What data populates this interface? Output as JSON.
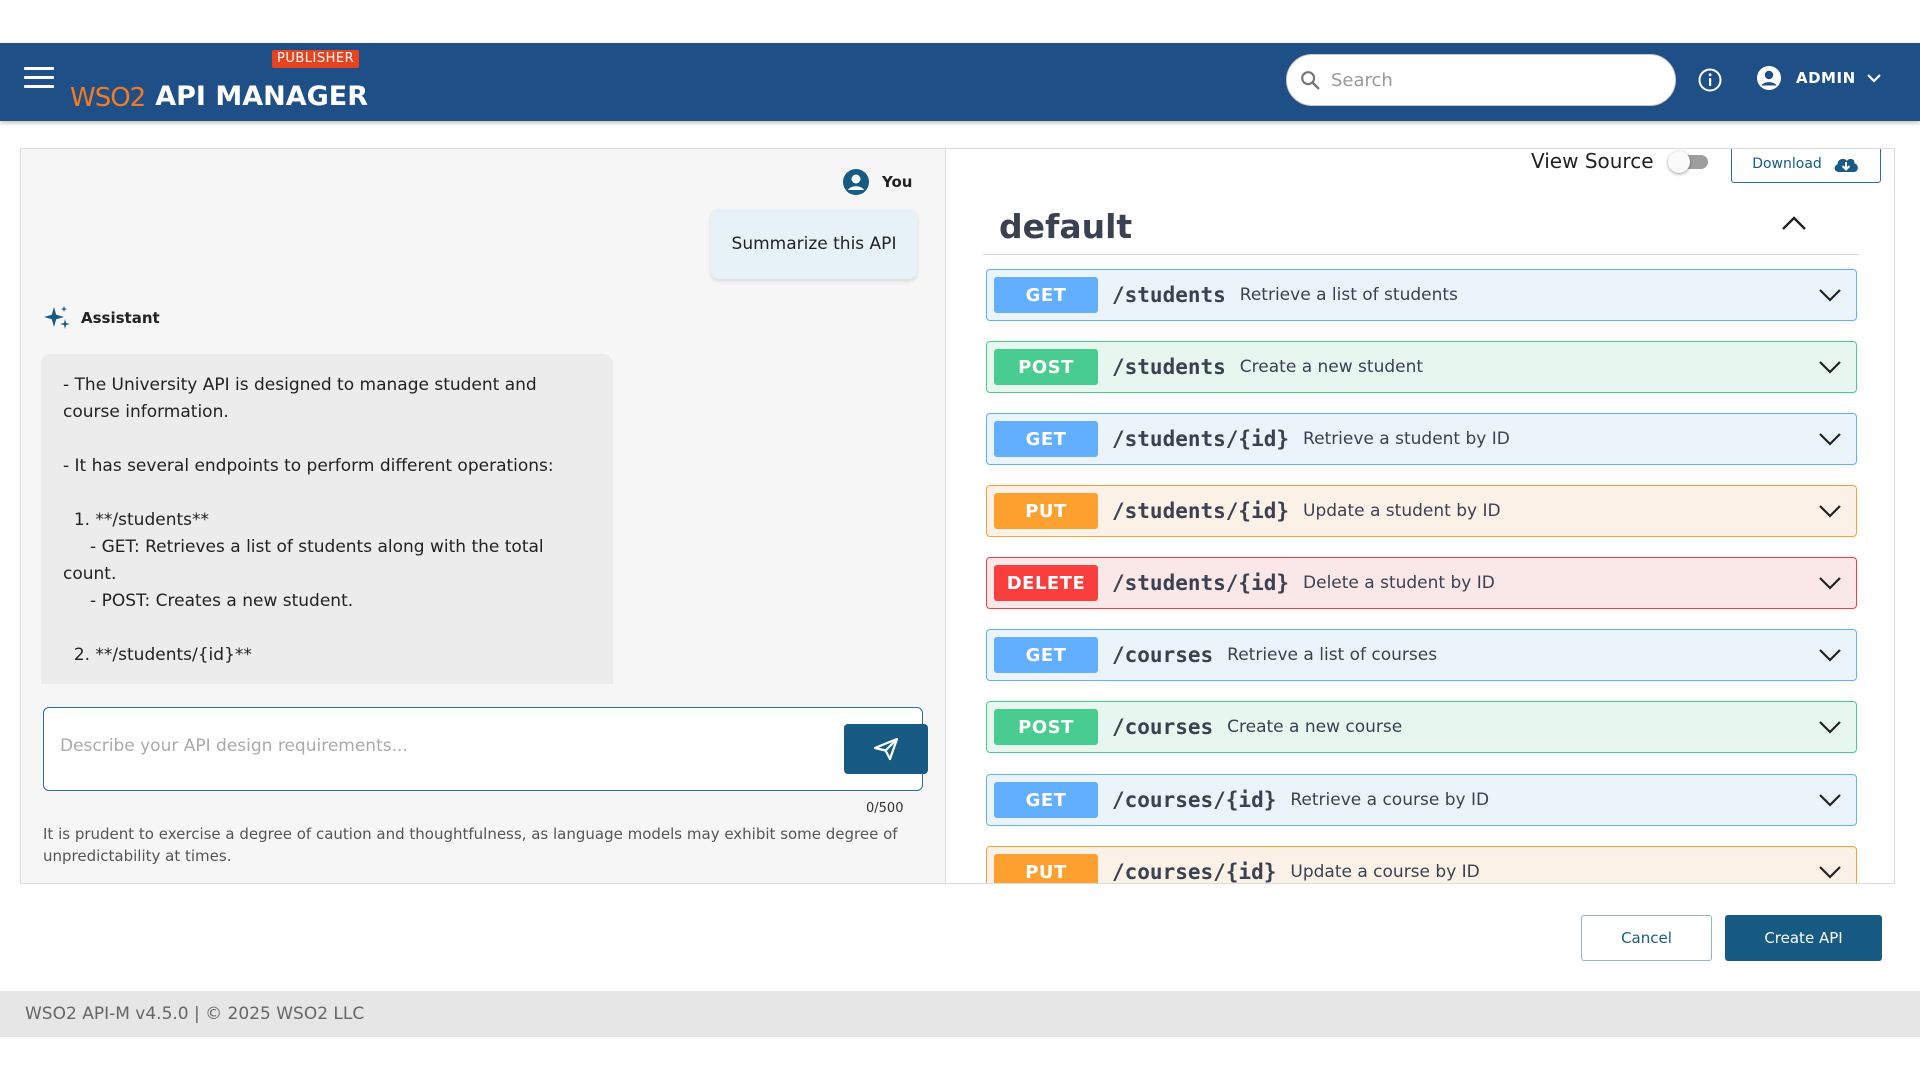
{
  "header": {
    "logo_text": "WSO2",
    "logo_sub": "2",
    "app_title": "API MANAGER",
    "badge": "PUBLISHER",
    "search_placeholder": "Search",
    "user_name": "ADMIN"
  },
  "chat": {
    "user_label": "You",
    "user_message": "Summarize this API",
    "assistant_label": "Assistant",
    "assistant_message": "- The University API is designed to manage student and course information.\n\n- It has several endpoints to perform different operations:\n\n  1. **/students**\n     - GET: Retrieves a list of students along with the total count.\n     - POST: Creates a new student.\n\n  2. **/students/{id}**",
    "input_placeholder": "Describe your API design requirements...",
    "counter": "0/500",
    "disclaimer": "It is prudent to exercise a degree of caution and thoughtfulness, as language models may exhibit some degree of unpredictability at times."
  },
  "preview": {
    "view_source_label": "View Source",
    "download_label": "Download",
    "section_title": "default",
    "operations": [
      {
        "method": "GET",
        "path": "/students",
        "summary": "Retrieve a list of students",
        "kind": "get"
      },
      {
        "method": "POST",
        "path": "/students",
        "summary": "Create a new student",
        "kind": "post"
      },
      {
        "method": "GET",
        "path": "/students/{id}",
        "summary": "Retrieve a student by ID",
        "kind": "get"
      },
      {
        "method": "PUT",
        "path": "/students/{id}",
        "summary": "Update a student by ID",
        "kind": "put"
      },
      {
        "method": "DELETE",
        "path": "/students/{id}",
        "summary": "Delete a student by ID",
        "kind": "delete"
      },
      {
        "method": "GET",
        "path": "/courses",
        "summary": "Retrieve a list of courses",
        "kind": "get"
      },
      {
        "method": "POST",
        "path": "/courses",
        "summary": "Create a new course",
        "kind": "post"
      },
      {
        "method": "GET",
        "path": "/courses/{id}",
        "summary": "Retrieve a course by ID",
        "kind": "get"
      },
      {
        "method": "PUT",
        "path": "/courses/{id}",
        "summary": "Update a course by ID",
        "kind": "put"
      }
    ]
  },
  "actions": {
    "cancel_label": "Cancel",
    "create_label": "Create API"
  },
  "footer": {
    "text": "WSO2 API-M v4.5.0 | © 2025 WSO2 LLC"
  },
  "colors": {
    "header_bg": "#1f4f87",
    "primary": "#175b85",
    "get": "#61affe",
    "post": "#49cc90",
    "put": "#fca130",
    "delete": "#f93e3e",
    "badge": "#e8431f"
  },
  "icons": [
    "menu-icon",
    "search-icon",
    "info-icon",
    "account-icon",
    "chevron-down-icon",
    "sparkle-icon",
    "send-icon",
    "cloud-download-icon",
    "chevron-up-icon"
  ]
}
